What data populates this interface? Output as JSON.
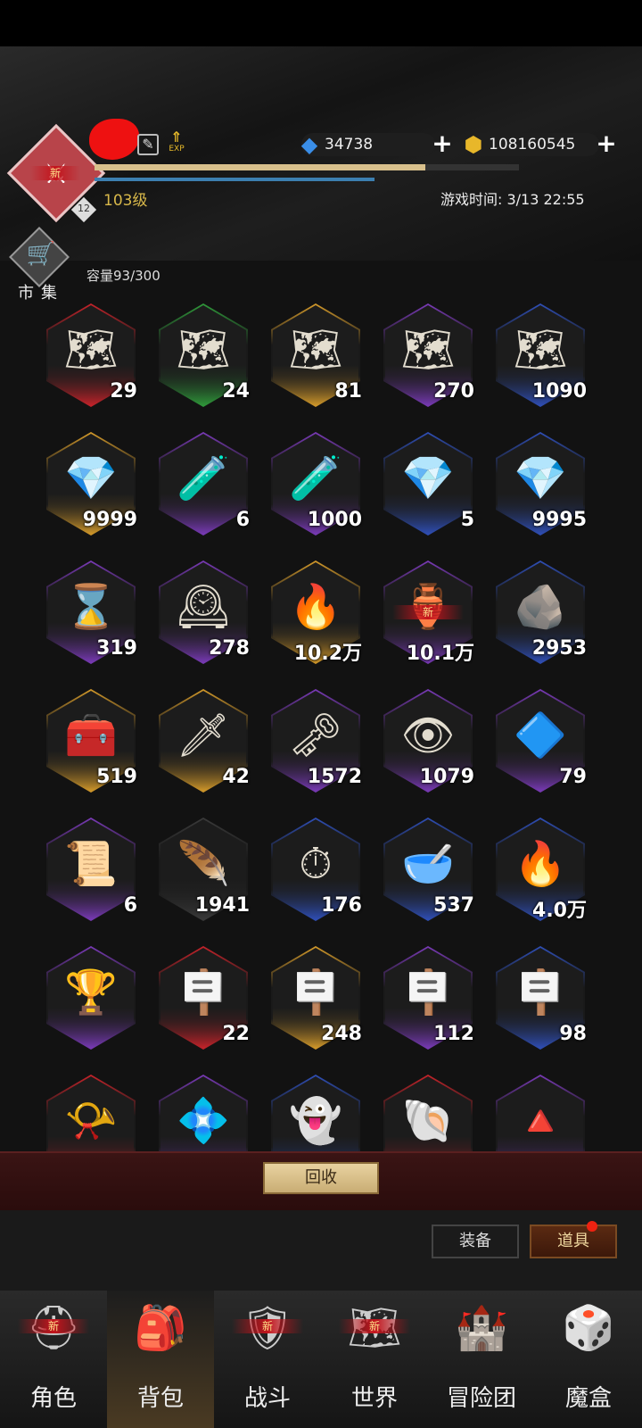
{
  "header": {
    "title": "",
    "new_tag": "新",
    "level_badge": "12",
    "level": "103级",
    "exp_label": "EXP",
    "exp_progress_fraction": 0.78,
    "gems": "34738",
    "gold": "108160545",
    "game_time": "游戏时间: 3/13 22:55"
  },
  "market": {
    "label": "市集"
  },
  "capacity": "容量93/300",
  "items": [
    {
      "icon": "treasure-map",
      "glyph": "🗺",
      "count": "29",
      "color": "#c7232a"
    },
    {
      "icon": "treasure-map",
      "glyph": "🗺",
      "count": "24",
      "color": "#2f9a3a"
    },
    {
      "icon": "treasure-map",
      "glyph": "🗺",
      "count": "81",
      "color": "#d49a2a"
    },
    {
      "icon": "treasure-map",
      "glyph": "🗺",
      "count": "270",
      "color": "#7a3ab8"
    },
    {
      "icon": "treasure-map",
      "glyph": "🗺",
      "count": "1090",
      "color": "#2f4fb8"
    },
    {
      "icon": "crystal-chest",
      "glyph": "💎",
      "count": "9999",
      "color": "#d49a2a"
    },
    {
      "icon": "test-tube",
      "glyph": "🧪",
      "count": "6",
      "color": "#7a3ab8"
    },
    {
      "icon": "test-tube",
      "glyph": "🧪",
      "count": "1000",
      "color": "#7a3ab8"
    },
    {
      "icon": "crystal-chest",
      "glyph": "💎",
      "count": "5",
      "color": "#2f4fb8"
    },
    {
      "icon": "crystal-chest",
      "glyph": "💎",
      "count": "9995",
      "color": "#2f4fb8"
    },
    {
      "icon": "hourglass",
      "glyph": "⌛",
      "count": "319",
      "color": "#7a3ab8"
    },
    {
      "icon": "clock",
      "glyph": "🕰",
      "count": "278",
      "color": "#7a3ab8"
    },
    {
      "icon": "flame",
      "glyph": "🔥",
      "count": "10.2万",
      "color": "#d49a2a"
    },
    {
      "icon": "jar",
      "glyph": "🏺",
      "count": "10.1万",
      "color": "#7a3ab8",
      "new": "新"
    },
    {
      "icon": "rock",
      "glyph": "🪨",
      "count": "2953",
      "color": "#2f4fb8"
    },
    {
      "icon": "chest",
      "glyph": "🧰",
      "count": "519",
      "color": "#d49a2a"
    },
    {
      "icon": "sword-fragment",
      "glyph": "🗡",
      "count": "42",
      "color": "#d49a2a"
    },
    {
      "icon": "key",
      "glyph": "🗝",
      "count": "1572",
      "color": "#7a3ab8"
    },
    {
      "icon": "eye-stone",
      "glyph": "👁",
      "count": "1079",
      "color": "#7a3ab8"
    },
    {
      "icon": "crystals",
      "glyph": "🔷",
      "count": "79",
      "color": "#7a3ab8"
    },
    {
      "icon": "scroll",
      "glyph": "📜",
      "count": "6",
      "color": "#7a3ab8"
    },
    {
      "icon": "shard",
      "glyph": "🪶",
      "count": "1941",
      "color": "#3a3a3a"
    },
    {
      "icon": "pocket-watch",
      "glyph": "⏱",
      "count": "176",
      "color": "#2f4fb8"
    },
    {
      "icon": "bowl",
      "glyph": "🥣",
      "count": "537",
      "color": "#2f4fb8"
    },
    {
      "icon": "torch",
      "glyph": "🔥",
      "count": "4.0万",
      "color": "#2f4fb8"
    },
    {
      "icon": "chalice",
      "glyph": "🏆",
      "count": "",
      "color": "#7a3ab8"
    },
    {
      "icon": "rune-tablet",
      "glyph": "🪧",
      "count": "22",
      "color": "#c7232a"
    },
    {
      "icon": "rune-tablet",
      "glyph": "🪧",
      "count": "248",
      "color": "#d49a2a"
    },
    {
      "icon": "rune-tablet",
      "glyph": "🪧",
      "count": "112",
      "color": "#7a3ab8"
    },
    {
      "icon": "rune-tablet",
      "glyph": "🪧",
      "count": "98",
      "color": "#2f4fb8"
    },
    {
      "icon": "horn",
      "glyph": "📯",
      "count": "",
      "color": "#c7232a"
    },
    {
      "icon": "gem",
      "glyph": "💠",
      "count": "",
      "color": "#7a3ab8"
    },
    {
      "icon": "spirit",
      "glyph": "👻",
      "count": "",
      "color": "#2f4fb8"
    },
    {
      "icon": "spiked-shell",
      "glyph": "🐚",
      "count": "",
      "color": "#c7232a"
    },
    {
      "icon": "pyramid",
      "glyph": "🔺",
      "count": "",
      "color": "#7a3ab8"
    }
  ],
  "recycle_label": "回收",
  "tabs": {
    "equip": "装备",
    "items": "道具"
  },
  "bottom_nav": [
    {
      "label": "角色",
      "icon": "helmet",
      "glyph": "⛑",
      "new": "新"
    },
    {
      "label": "背包",
      "icon": "backpack",
      "glyph": "🎒",
      "active": true
    },
    {
      "label": "战斗",
      "icon": "shield-sword",
      "glyph": "🛡",
      "new": "新"
    },
    {
      "label": "世界",
      "icon": "map-scroll",
      "glyph": "🗺",
      "new": "新"
    },
    {
      "label": "冒险团",
      "icon": "castle",
      "glyph": "🏰"
    },
    {
      "label": "魔盒",
      "icon": "cube",
      "glyph": "🎲"
    }
  ]
}
